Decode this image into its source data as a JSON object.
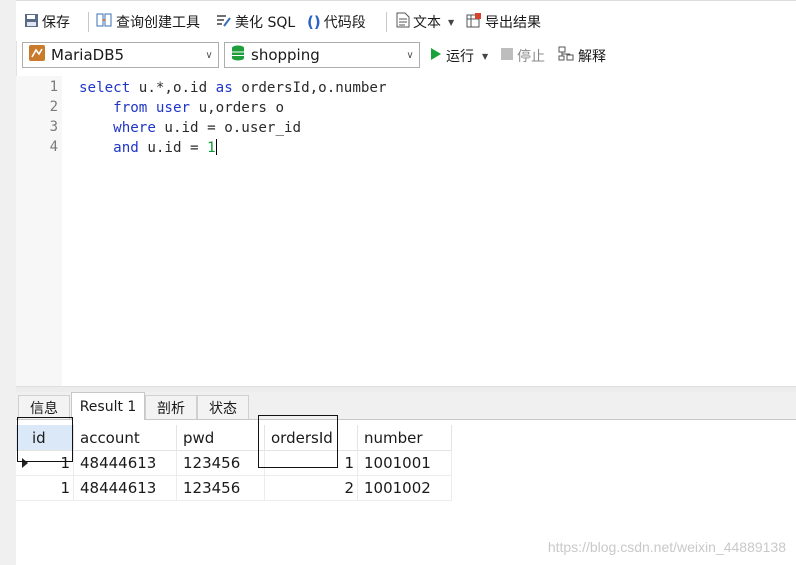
{
  "toolbar": {
    "save_label": "保存",
    "query_builder_label": "查询创建工具",
    "beautify_label": "美化 SQL",
    "snippet_label": "代码段",
    "text_label": "文本",
    "export_label": "导出结果"
  },
  "selectors": {
    "connection": "MariaDB5",
    "database": "shopping",
    "run_label": "运行",
    "stop_label": "停止",
    "explain_label": "解释"
  },
  "editor": {
    "line_numbers": [
      "1",
      "2",
      "3",
      "4"
    ],
    "lines": [
      {
        "kw1": "select",
        "t1": " u.*,o.id ",
        "kw2": "as",
        "t2": " ordersId,o.number"
      },
      {
        "indent": "    ",
        "kw1": "from",
        "t1": " ",
        "kw2": "user",
        "t2": " u,orders o"
      },
      {
        "indent": "    ",
        "kw1": "where",
        "t1": " u.id = o.user_id"
      },
      {
        "indent": "    ",
        "kw1": "and",
        "t1": " u.id = ",
        "num": "1"
      }
    ]
  },
  "result_tabs": [
    "信息",
    "Result 1",
    "剖析",
    "状态"
  ],
  "active_tab": "Result 1",
  "result": {
    "columns": [
      "id",
      "account",
      "pwd",
      "ordersId",
      "number"
    ],
    "rows": [
      [
        "1",
        "48444613",
        "123456",
        "1",
        "1001001"
      ],
      [
        "1",
        "48444613",
        "123456",
        "2",
        "1001002"
      ]
    ]
  },
  "watermark": "https://blog.csdn.net/weixin_44889138",
  "colors": {
    "keyword": "#1f36c9",
    "number_literal": "#0a9a3a",
    "run_green": "#1aa33a"
  },
  "icons": [
    "save-icon",
    "query-builder-icon",
    "beautify-icon",
    "snippet-icon",
    "text-icon",
    "export-icon",
    "database-connection-icon",
    "database-icon",
    "run-icon",
    "stop-icon",
    "explain-icon",
    "row-pointer-icon"
  ]
}
